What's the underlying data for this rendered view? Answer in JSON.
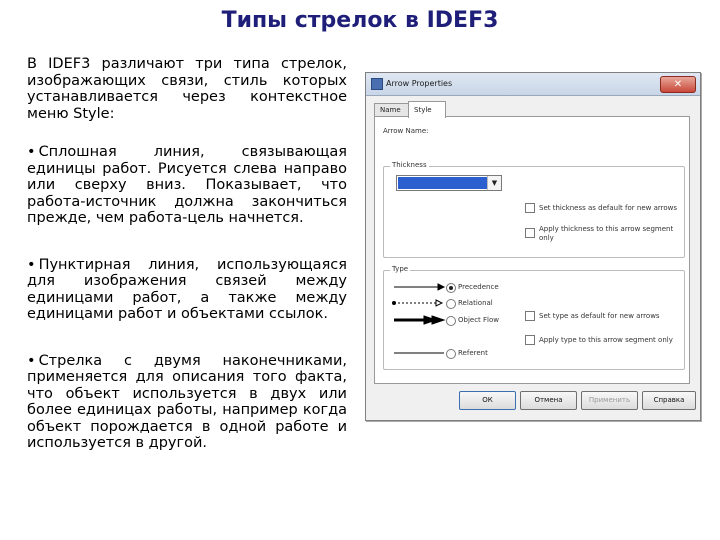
{
  "title": "Типы стрелок в IDEF3",
  "text": {
    "intro": "В IDEF3 различают три типа стрелок, изображающих связи, стиль которых устанавливается через контекстное меню Style:",
    "bullet1": "Сплошная линия, связывающая единицы работ. Рисуется слева направо или сверху вниз. Показывает, что работа-источник должна закончиться прежде, чем работа-цель начнется.",
    "bullet2": "Пунктирная линия, использующаяся для изображения связей между единицами работ, а также между единицами работ и объектами ссылок.",
    "bullet3": "Стрелка с двумя наконечниками, применяется для описания того факта, что объект используется в двух или более единицах работы, например когда объект порождается в одной работе и используется в другой."
  },
  "dialog": {
    "title": "Arrow Properties",
    "close_label": "✕",
    "tabs": [
      {
        "label": "Name",
        "active": false
      },
      {
        "label": "Style",
        "active": true
      }
    ],
    "arrow_name_label": "Arrow Name:",
    "thickness": {
      "group_label": "Thickness",
      "selected_value": "",
      "check_default_label": "Set thickness as default for new arrows",
      "check_apply_label_1": "Apply thickness to this arrow segment",
      "check_apply_label_2": "only",
      "check_default": false,
      "check_apply": false
    },
    "type": {
      "group_label": "Type",
      "options": [
        {
          "label": "Precedence",
          "selected": true,
          "line": "solid"
        },
        {
          "label": "Relational",
          "selected": false,
          "line": "dashed"
        },
        {
          "label": "Object Flow",
          "selected": false,
          "line": "double"
        },
        {
          "label": "Referent",
          "selected": false,
          "line": "solid-plain"
        }
      ],
      "check_default_label": "Set type as default for new arrows",
      "check_apply_label": "Apply type to this arrow segment only",
      "check_default": false,
      "check_apply": false
    },
    "buttons": {
      "ok": "ОК",
      "cancel": "Отмена",
      "apply": "Применить",
      "help": "Справка"
    },
    "colors": {
      "selection": "#2b5fd0",
      "title_text": "#1f1f7a"
    }
  }
}
